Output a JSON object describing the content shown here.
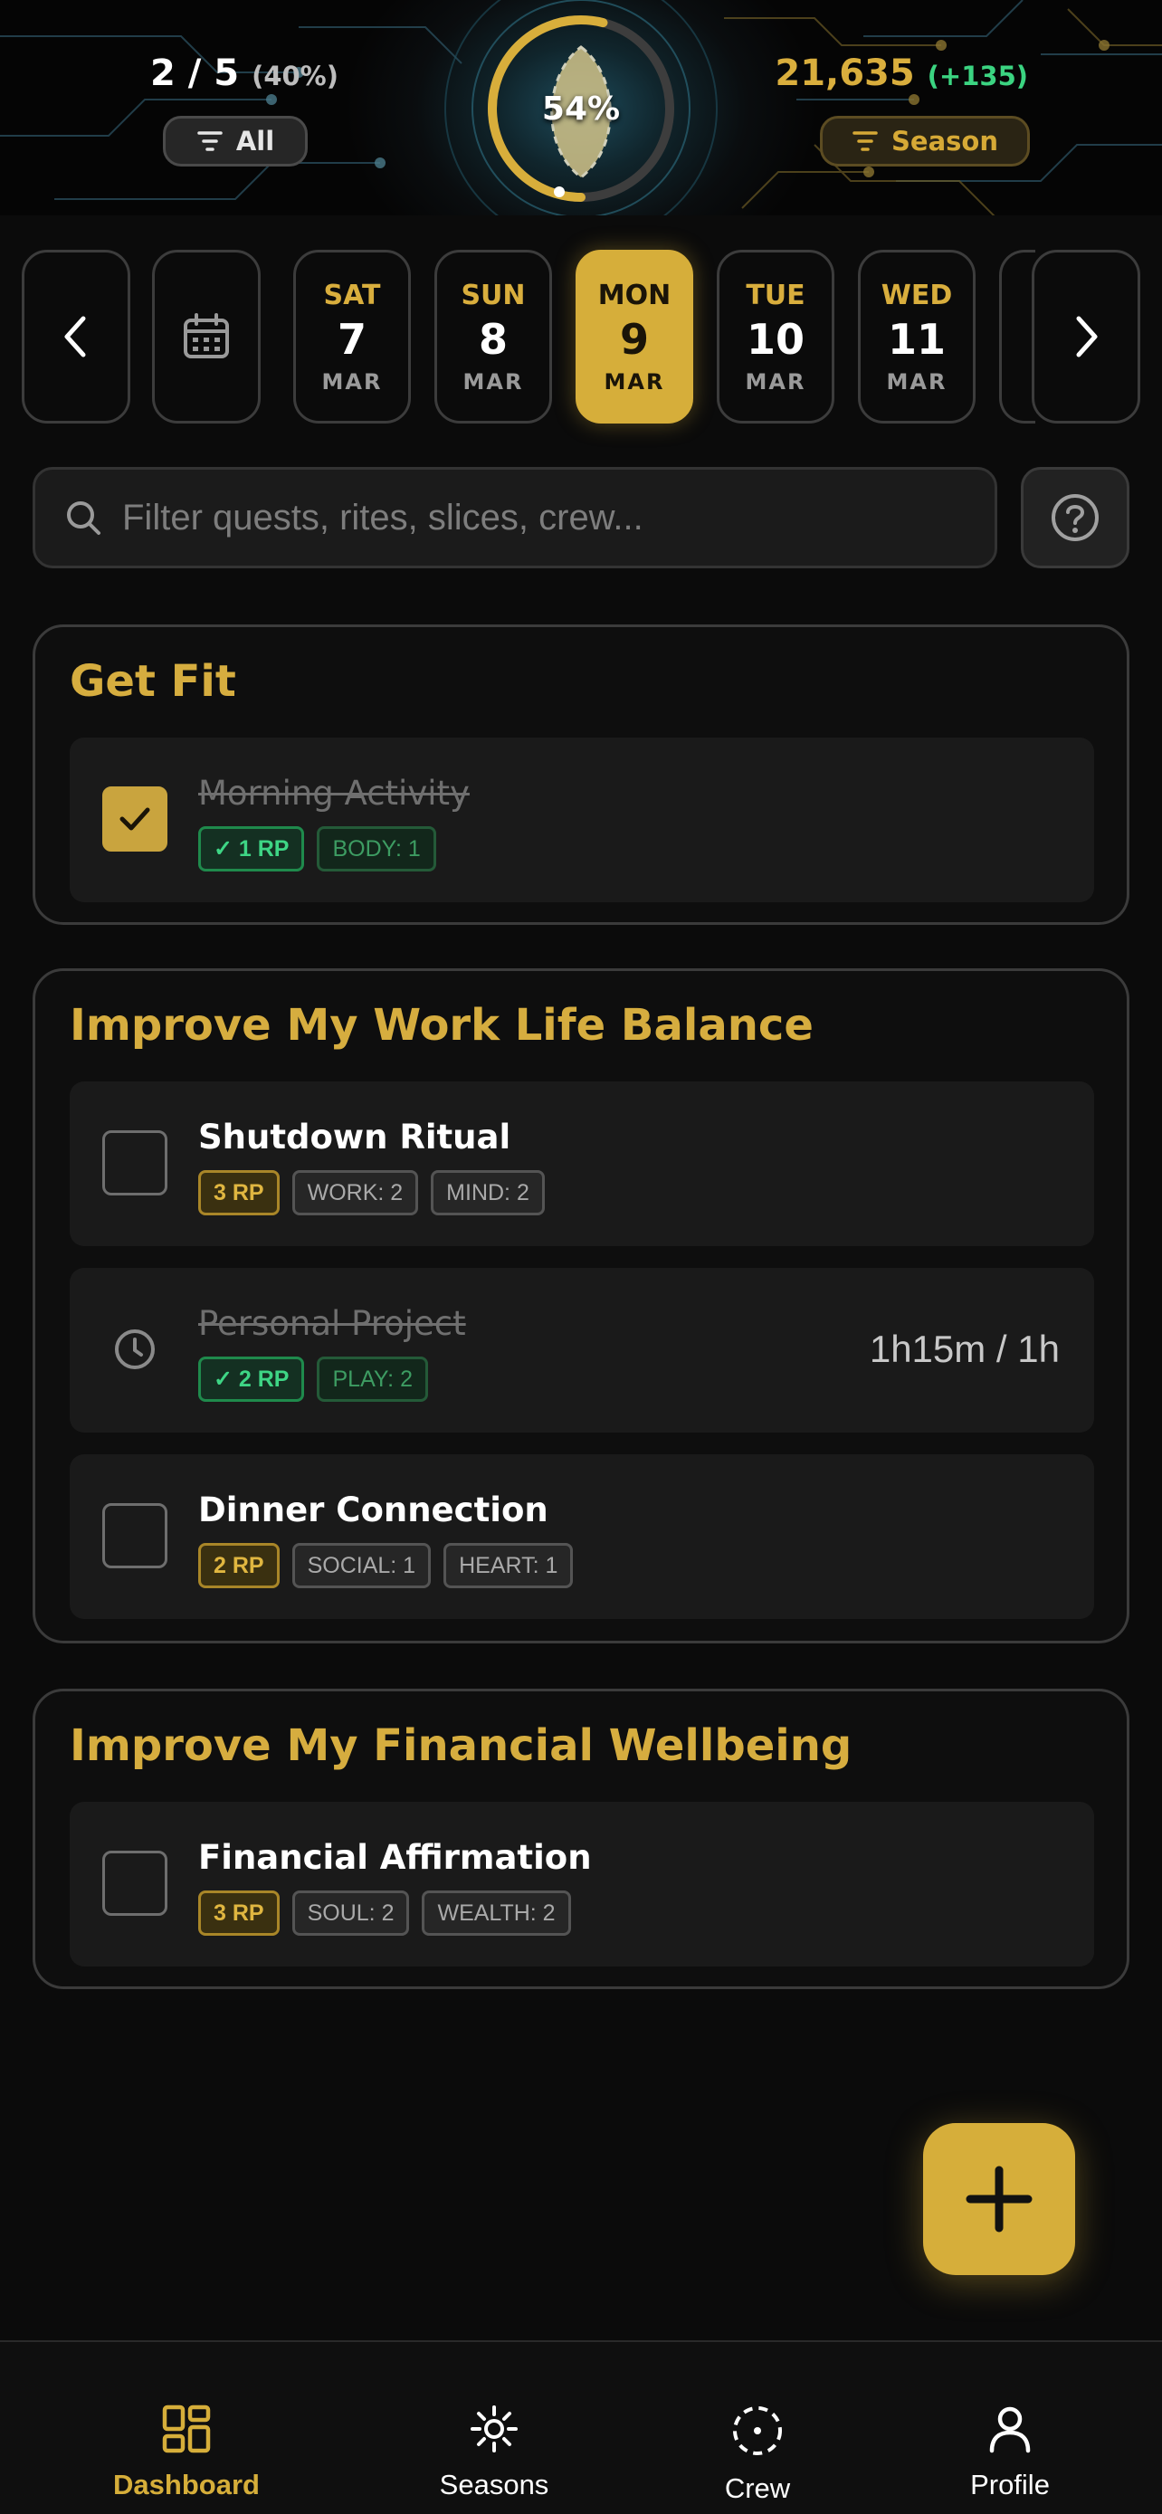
{
  "hero": {
    "completed": "2 / 5",
    "completed_pct": "(40%)",
    "ring_percent": "54%",
    "ring_fraction": 0.54,
    "filter_all_label": "All",
    "points": "21,635",
    "points_delta": "(+135)",
    "filter_season_label": "Season"
  },
  "dates": [
    {
      "weekday": "SAT",
      "day": "7",
      "month": "MAR",
      "selected": false
    },
    {
      "weekday": "SUN",
      "day": "8",
      "month": "MAR",
      "selected": false
    },
    {
      "weekday": "MON",
      "day": "9",
      "month": "MAR",
      "selected": true
    },
    {
      "weekday": "TUE",
      "day": "10",
      "month": "MAR",
      "selected": false
    },
    {
      "weekday": "WED",
      "day": "11",
      "month": "MAR",
      "selected": false
    }
  ],
  "search": {
    "placeholder": "Filter quests, rites, slices, crew..."
  },
  "groups": [
    {
      "title": "Get Fit",
      "tasks": [
        {
          "title": "Morning Activity",
          "done": true,
          "rp": "✓ 1 RP",
          "stats": [
            "BODY: 1"
          ]
        }
      ]
    },
    {
      "title": "Improve My Work Life Balance",
      "tasks": [
        {
          "title": "Shutdown Ritual",
          "done": false,
          "rp": "3 RP",
          "stats": [
            "WORK: 2",
            "MIND: 2"
          ]
        },
        {
          "title": "Personal Project",
          "done": true,
          "timed": true,
          "rp": "✓ 2 RP",
          "stats": [
            "PLAY: 2"
          ],
          "timer": "1h15m / 1h"
        },
        {
          "title": "Dinner Connection",
          "done": false,
          "rp": "2 RP",
          "stats": [
            "SOCIAL: 1",
            "HEART: 1"
          ]
        }
      ]
    },
    {
      "title": "Improve My Financial Wellbeing",
      "tasks": [
        {
          "title": "Financial Affirmation",
          "done": false,
          "rp": "3 RP",
          "stats": [
            "SOUL: 2",
            "WEALTH: 2"
          ]
        }
      ]
    }
  ],
  "nav": {
    "dashboard": "Dashboard",
    "seasons": "Seasons",
    "crew": "Crew",
    "profile": "Profile"
  },
  "colors": {
    "accent": "#d6ae3a",
    "success": "#3ed585",
    "background": "#0b0b0b"
  }
}
